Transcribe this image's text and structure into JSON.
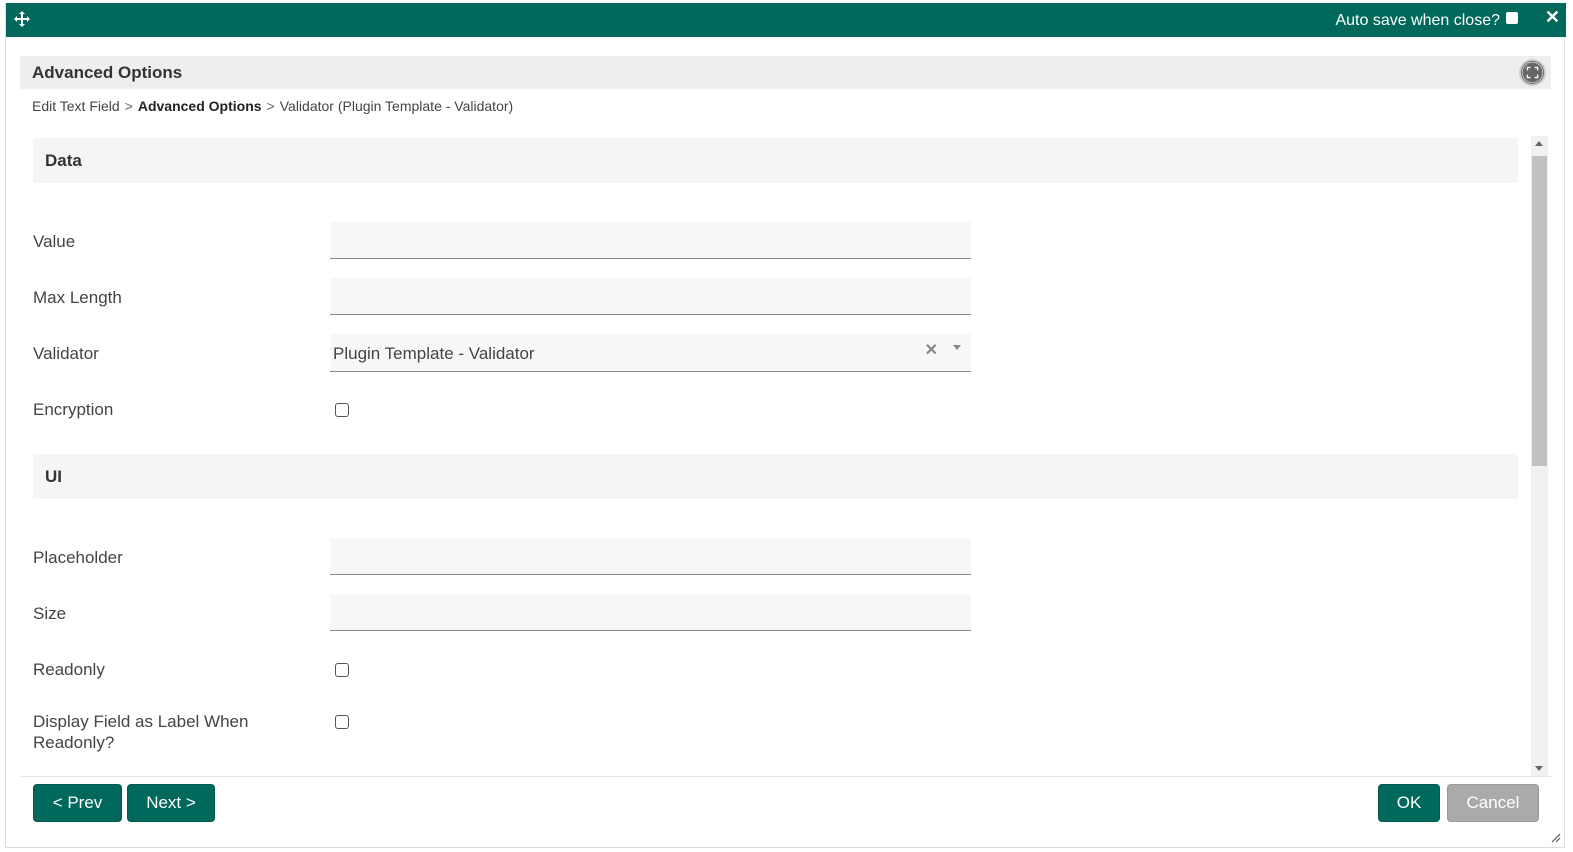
{
  "titlebar": {
    "autosave_label": "Auto save when close?",
    "close_symbol": "✕",
    "move_icon": "move-icon"
  },
  "header": {
    "title": "Advanced Options",
    "fullscreen_icon": "fullscreen-icon"
  },
  "breadcrumb": {
    "items": [
      "Edit Text Field",
      "Advanced Options",
      "Validator (Plugin Template - Validator)"
    ],
    "separator": ">"
  },
  "sections": {
    "data": {
      "title": "Data",
      "value_label": "Value",
      "value": "",
      "maxlength_label": "Max Length",
      "maxlength": "",
      "validator_label": "Validator",
      "validator_value": "Plugin Template - Validator",
      "encryption_label": "Encryption",
      "encryption_checked": false
    },
    "ui": {
      "title": "UI",
      "placeholder_label": "Placeholder",
      "placeholder": "",
      "size_label": "Size",
      "size": "",
      "readonly_label": "Readonly",
      "readonly_checked": false,
      "display_label_line1": "Display Field as Label When",
      "display_label_line2": "Readonly?",
      "display_checked": false
    }
  },
  "footer": {
    "prev_label": "< Prev",
    "next_label": "Next >",
    "ok_label": "OK",
    "cancel_label": "Cancel"
  },
  "colors": {
    "primary": "#00695c",
    "disabled": "#aaaaaa"
  }
}
